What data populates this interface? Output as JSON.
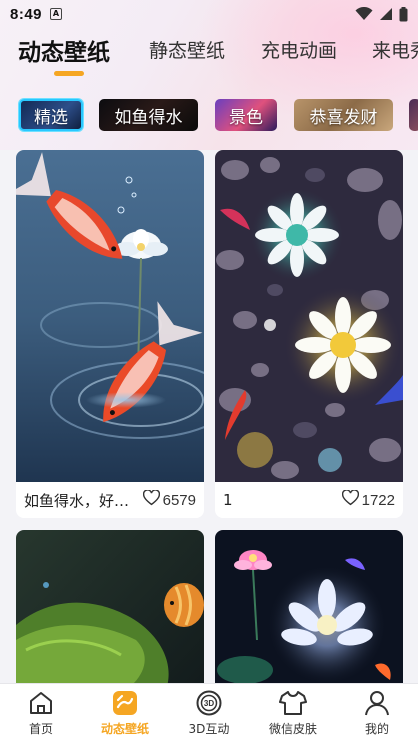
{
  "status_bar": {
    "time": "8:49",
    "sim_icon_letter": "A"
  },
  "category_tabs": [
    {
      "label": "动态壁纸",
      "active": true
    },
    {
      "label": "静态壁纸",
      "active": false
    },
    {
      "label": "充电动画",
      "active": false
    },
    {
      "label": "来电秀",
      "active": false
    }
  ],
  "chips": [
    {
      "label": "精选",
      "active": true
    },
    {
      "label": "如鱼得水",
      "active": false
    },
    {
      "label": "景色",
      "active": false
    },
    {
      "label": "恭喜发财",
      "active": false
    }
  ],
  "wallpapers": [
    {
      "title": "如鱼得水，好运连连",
      "likes": "6579",
      "thumbnail": "koi-fish-lotus"
    },
    {
      "title": "1",
      "likes": "1722",
      "thumbnail": "glowing-flowers-pebbles"
    },
    {
      "title": "",
      "likes": "",
      "thumbnail": "mossy-rock-fish"
    },
    {
      "title": "",
      "likes": "",
      "thumbnail": "neon-lotus-night"
    }
  ],
  "bottom_nav": [
    {
      "label": "首页",
      "icon": "home-icon",
      "active": false
    },
    {
      "label": "动态壁纸",
      "icon": "live-wallpaper-icon",
      "active": true
    },
    {
      "label": "3D互动",
      "icon": "3d-icon",
      "active": false
    },
    {
      "label": "微信皮肤",
      "icon": "tshirt-icon",
      "active": false
    },
    {
      "label": "我的",
      "icon": "profile-icon",
      "active": false
    }
  ],
  "colors": {
    "accent": "#f5a623",
    "chip_active_border": "#29c8ff",
    "background": "#f3f3f7"
  }
}
